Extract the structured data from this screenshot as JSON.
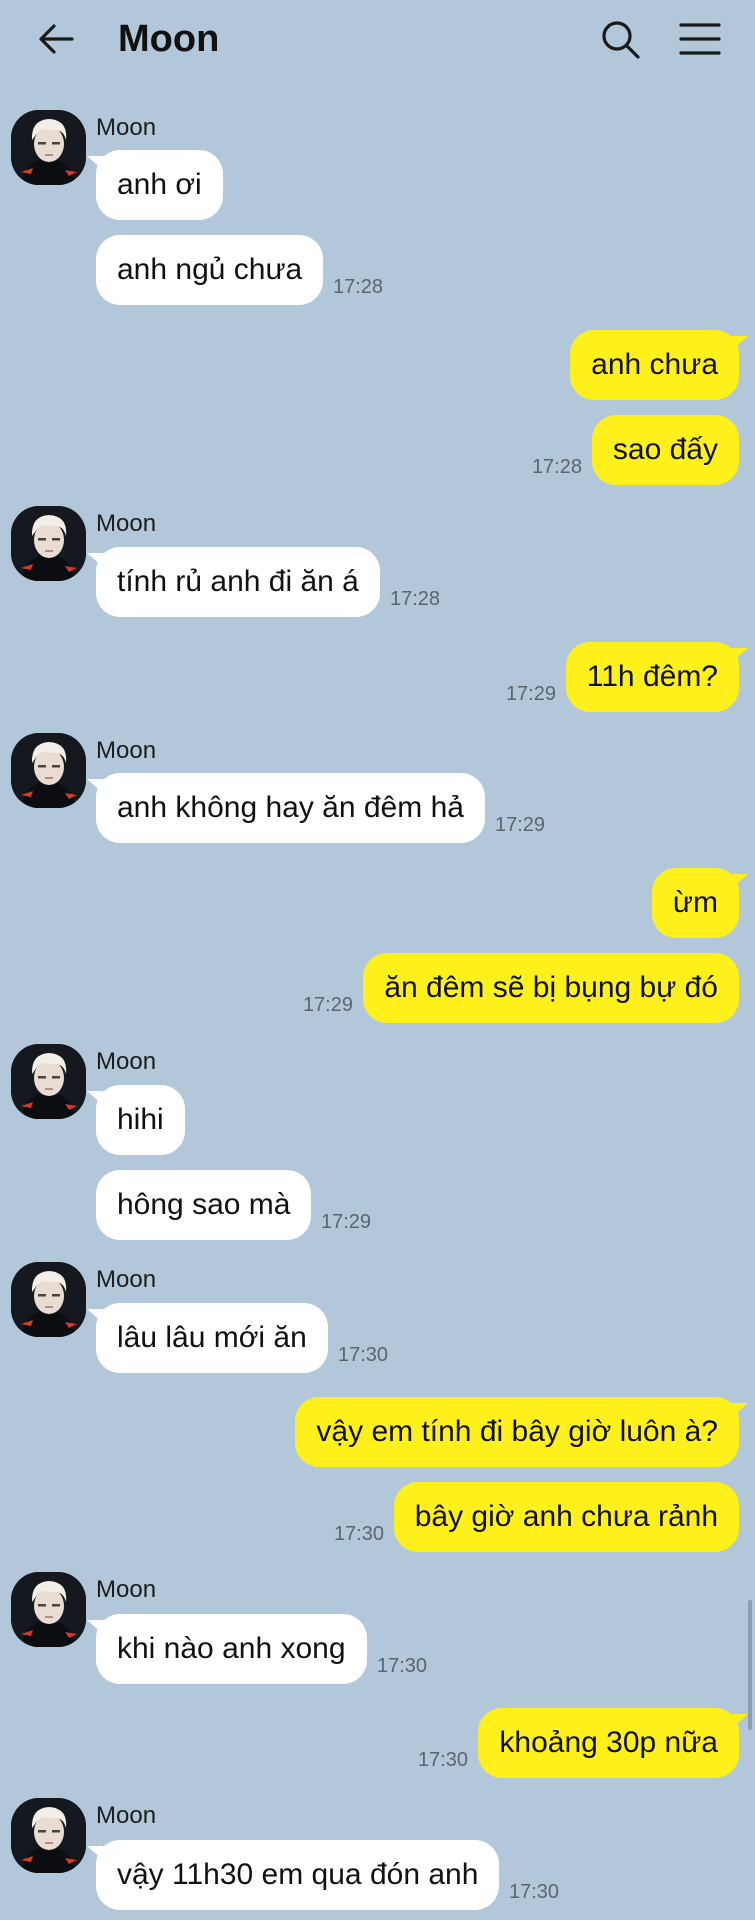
{
  "header": {
    "title": "Moon",
    "back_icon": "arrow-left-icon",
    "search_icon": "search-icon",
    "menu_icon": "hamburger-menu-icon"
  },
  "colors": {
    "background": "#b2c7d9",
    "incoming_bubble": "#ffffff",
    "outgoing_bubble": "#fef01b"
  },
  "messages": [
    {
      "group": 1,
      "sender": "Moon",
      "dir": "in",
      "text": "anh ơi",
      "time": ""
    },
    {
      "group": 1,
      "sender": "Moon",
      "dir": "in",
      "text": "anh ngủ chưa",
      "time": "17:28"
    },
    {
      "group": 2,
      "dir": "out",
      "text": "anh chưa",
      "time": ""
    },
    {
      "group": 2,
      "dir": "out",
      "text": "sao đấy",
      "time": "17:28"
    },
    {
      "group": 3,
      "sender": "Moon",
      "dir": "in",
      "text": "tính rủ anh đi ăn á",
      "time": "17:28"
    },
    {
      "group": 4,
      "dir": "out",
      "text": "11h đêm?",
      "time": "17:29"
    },
    {
      "group": 5,
      "sender": "Moon",
      "dir": "in",
      "text": "anh không hay ăn đêm hả",
      "time": "17:29"
    },
    {
      "group": 6,
      "dir": "out",
      "text": "ừm",
      "time": ""
    },
    {
      "group": 6,
      "dir": "out",
      "text": "ăn đêm sẽ bị bụng bự đó",
      "time": "17:29"
    },
    {
      "group": 7,
      "sender": "Moon",
      "dir": "in",
      "text": "hihi",
      "time": ""
    },
    {
      "group": 7,
      "sender": "Moon",
      "dir": "in",
      "text": "hông sao mà",
      "time": "17:29"
    },
    {
      "group": 8,
      "sender": "Moon",
      "dir": "in",
      "text": "lâu lâu mới ăn",
      "time": "17:30"
    },
    {
      "group": 9,
      "dir": "out",
      "text": "vậy em tính đi bây giờ luôn à?",
      "time": ""
    },
    {
      "group": 9,
      "dir": "out",
      "text": "bây giờ anh chưa rảnh",
      "time": "17:30"
    },
    {
      "group": 10,
      "sender": "Moon",
      "dir": "in",
      "text": "khi nào anh xong",
      "time": "17:30"
    },
    {
      "group": 11,
      "dir": "out",
      "text": "khoảng 30p nữa",
      "time": "17:30"
    },
    {
      "group": 12,
      "sender": "Moon",
      "dir": "in",
      "text": "vậy 11h30 em qua đón anh",
      "time": "17:30"
    }
  ]
}
